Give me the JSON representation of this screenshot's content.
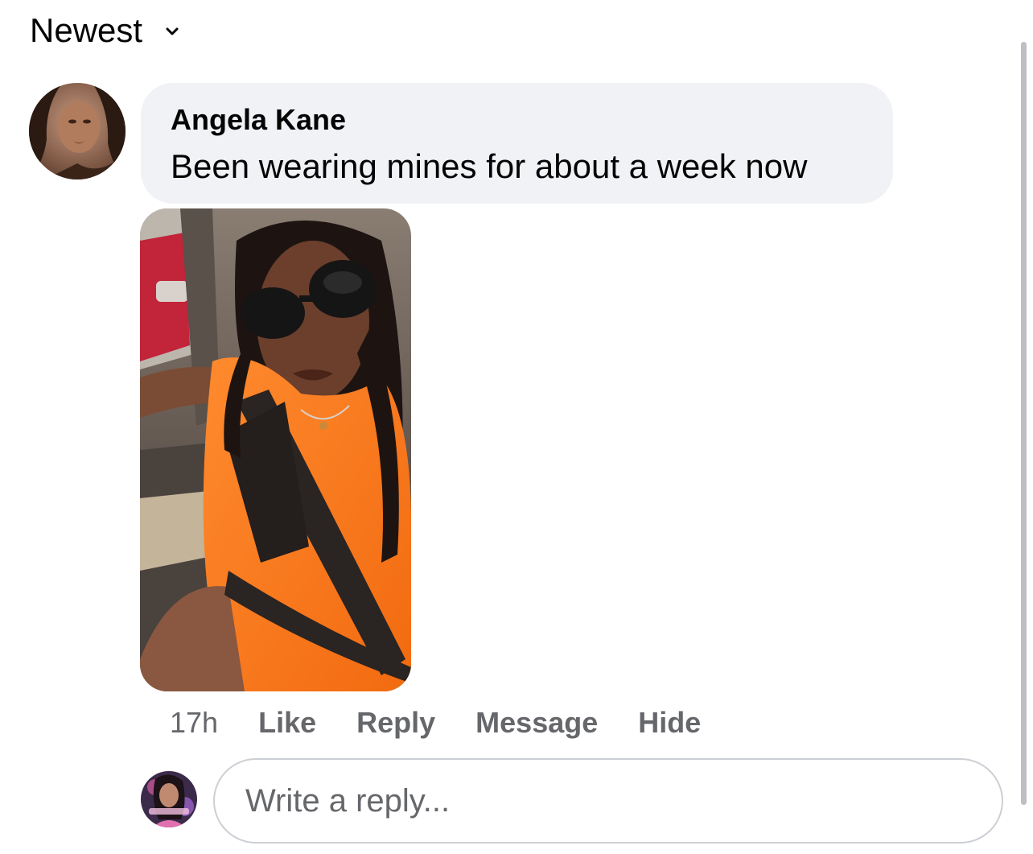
{
  "sort": {
    "label": "Newest",
    "chevron_icon": "chevron-down-icon"
  },
  "comment": {
    "author": "Angela Kane",
    "text": "Been wearing mines for about a week now",
    "avatar_icon": "user-avatar",
    "photo": "photo-of-woman-in-orange-dress-wearing-seatbelt-cover",
    "time": "17h",
    "actions": {
      "like": "Like",
      "reply": "Reply",
      "message": "Message",
      "hide": "Hide"
    }
  },
  "reply": {
    "placeholder": "Write a reply...",
    "avatar_icon": "current-user-avatar"
  },
  "colors": {
    "bubble_bg": "#f0f2f5",
    "secondary_text": "#65676b",
    "primary_text": "#050505",
    "border": "#ccd0d5"
  }
}
